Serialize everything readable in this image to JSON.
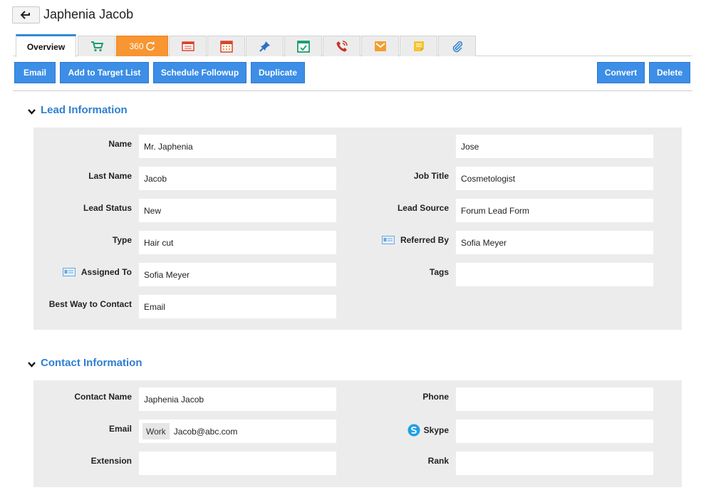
{
  "header": {
    "title": "Japhenia Jacob"
  },
  "tabs": {
    "overview_label": "Overview",
    "three_sixty_label": "360",
    "icons": [
      "cart-icon",
      "360-icon",
      "notes-list-icon",
      "calendar-icon",
      "pin-icon",
      "task-check-icon",
      "phone-icon",
      "email-icon",
      "sticky-note-icon",
      "attachment-icon"
    ]
  },
  "actions": {
    "email": "Email",
    "add_to_target_list": "Add to Target List",
    "schedule_followup": "Schedule Followup",
    "duplicate": "Duplicate",
    "convert": "Convert",
    "delete": "Delete"
  },
  "lead_information": {
    "title": "Lead Information",
    "name_label": "Name",
    "name_value": "Mr. Japhenia",
    "first_name_value": "Jose",
    "last_name_label": "Last Name",
    "last_name_value": "Jacob",
    "job_title_label": "Job Title",
    "job_title_value": "Cosmetologist",
    "lead_status_label": "Lead Status",
    "lead_status_value": "New",
    "lead_source_label": "Lead Source",
    "lead_source_value": "Forum Lead Form",
    "type_label": "Type",
    "type_value": "Hair cut",
    "referred_by_label": "Referred By",
    "referred_by_value": "Sofia Meyer",
    "assigned_to_label": "Assigned To",
    "assigned_to_value": "Sofia Meyer",
    "tags_label": "Tags",
    "tags_value": "",
    "best_way_label": "Best Way to Contact",
    "best_way_value": "Email"
  },
  "contact_information": {
    "title": "Contact Information",
    "contact_name_label": "Contact Name",
    "contact_name_value": "Japhenia Jacob",
    "phone_label": "Phone",
    "phone_value": "",
    "email_label": "Email",
    "email_type": "Work",
    "email_value": "Jacob@abc.com",
    "skype_label": "Skype",
    "skype_value": "",
    "extension_label": "Extension",
    "extension_value": "",
    "rank_label": "Rank",
    "rank_value": ""
  },
  "colors": {
    "accent_blue": "#3c8ee7",
    "section_title": "#2e7fd0",
    "tab_360_orange": "#f79632",
    "panel_bg": "#ececec"
  }
}
